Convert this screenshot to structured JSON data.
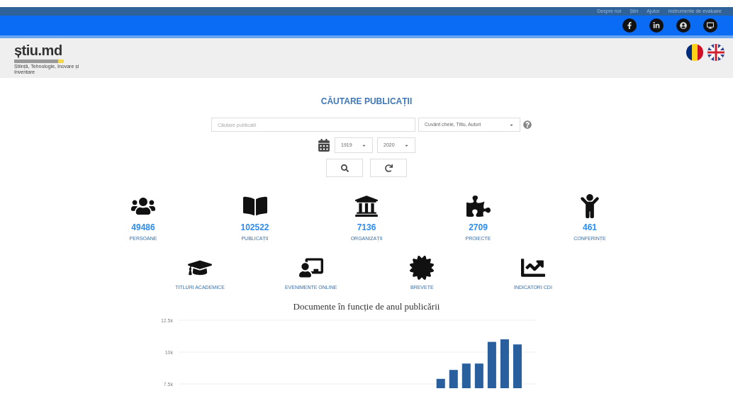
{
  "top_links": [
    "Despre noi",
    "Știri",
    "Ajutor",
    "Instrumente de evaluare"
  ],
  "logo": {
    "title": "știu.md",
    "subtitle": "Știință, Tehnologie, Inovare și Inventare"
  },
  "search": {
    "title": "CĂUTARE PUBLICAȚII",
    "placeholder": "Căutare publicații",
    "field_select": "Cuvânt cheie, Titlu, Autori",
    "year_from": "1919",
    "year_to": "2020"
  },
  "stats": [
    {
      "value": "49486",
      "label": "PERSOANE"
    },
    {
      "value": "102522",
      "label": "PUBLICAȚII"
    },
    {
      "value": "7136",
      "label": "ORGANIZAȚII"
    },
    {
      "value": "2709",
      "label": "PROIECTE"
    },
    {
      "value": "461",
      "label": "CONFERINȚE"
    }
  ],
  "sections": [
    "TITLURI ACADEMICE",
    "EVENIMENTE ONLINE",
    "BREVETE",
    "INDICATORI CDI"
  ],
  "chart": {
    "chart_data": {
      "type": "bar",
      "title": "Documente în funcție de anul publicării",
      "ylim": [
        0,
        12500
      ],
      "yticks": [
        {
          "value": 7500,
          "label": "7.5k"
        },
        {
          "value": 10000,
          "label": "10k"
        },
        {
          "value": 12500,
          "label": "12.5k"
        }
      ],
      "series": [
        {
          "color": "#2a5f9e",
          "values": [
            null,
            null,
            null,
            null,
            null,
            null,
            null,
            null,
            null,
            null,
            null,
            null,
            null,
            null,
            null,
            null,
            null,
            null,
            null,
            null,
            7900,
            8600,
            9100,
            9100,
            10800,
            11000,
            10600,
            null
          ]
        }
      ]
    }
  }
}
